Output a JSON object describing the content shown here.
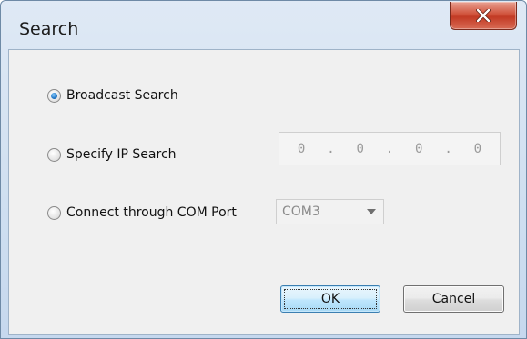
{
  "window": {
    "title": "Search"
  },
  "options": {
    "broadcast": {
      "label": "Broadcast Search",
      "checked": true
    },
    "specify_ip": {
      "label": "Specify IP Search",
      "checked": false
    },
    "com_port": {
      "label": "Connect through COM Port",
      "checked": false
    }
  },
  "ip_address": {
    "octets": [
      "0",
      "0",
      "0",
      "0"
    ],
    "separator": "."
  },
  "com_select": {
    "value": "COM3"
  },
  "buttons": {
    "ok": "OK",
    "cancel": "Cancel"
  },
  "icons": {
    "close": "close-icon",
    "dropdown": "chevron-down-icon"
  },
  "colors": {
    "close_button": "#c9432d",
    "ok_button_border": "#3c7fb1",
    "radio_checked": "#2379c9"
  }
}
